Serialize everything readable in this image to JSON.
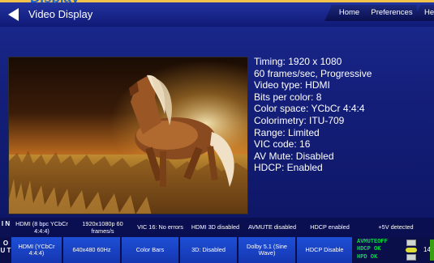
{
  "heading": {
    "text": "Display"
  },
  "window": {
    "title": "Video Display",
    "tabs": [
      "Home",
      "Preferences",
      "Help"
    ]
  },
  "preview": {
    "description_icon": "video-preview"
  },
  "info": [
    "Timing: 1920 x 1080",
    "60 frames/sec, Progressive",
    "Video type: HDMI",
    "Bits per color: 8",
    "Color space: YCbCr 4:4:4",
    "Colorimetry: ITU-709",
    "Range: Limited",
    "VIC code: 16",
    "AV Mute: Disabled",
    "HDCP: Enabled"
  ],
  "input_row": {
    "tag": "I N",
    "cells": [
      "HDMI (8 bpc YCbCr 4:4:4)",
      "1920x1080p 60 frames/s",
      "VIC 16: No errors",
      "HDMI 3D disabled",
      "AVMUTE disabled",
      "HDCP enabled",
      "+5V detected"
    ]
  },
  "output_row": {
    "tag": "O U T",
    "cells": [
      "HDMI (YCbCr 4:4:4)",
      "640x480 60Hz",
      "Color Bars",
      "3D: Disabled",
      "Dolby 5.1 (Sine Wave)",
      "HDCP Disable"
    ],
    "leds": [
      "AVMUTEOFF",
      "HDCP OK",
      "HPD OK"
    ],
    "edge_number": "14"
  },
  "colors": {
    "accent": "#1e63c9",
    "led_green": "#00e040",
    "button_blue": "#1e4fd6"
  }
}
